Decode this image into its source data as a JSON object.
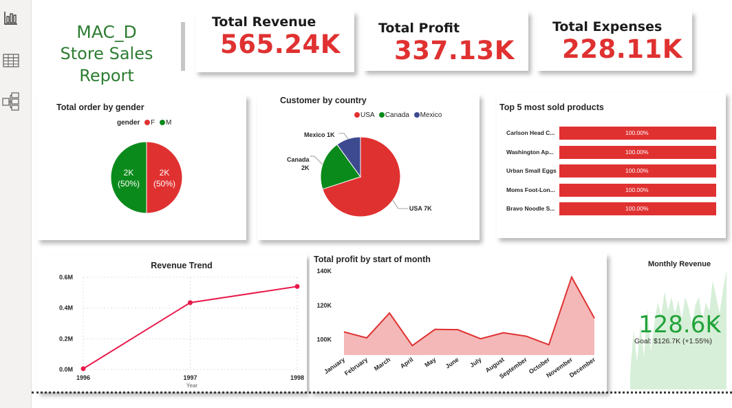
{
  "report": {
    "title_line1": "MAC_D",
    "title_line2": "Store Sales Report"
  },
  "kpis": [
    {
      "label": "Total Revenue",
      "value": "565.24K"
    },
    {
      "label": "Total Profit",
      "value": "337.13K"
    },
    {
      "label": "Total Expenses",
      "value": "228.11K"
    }
  ],
  "nav": [
    {
      "name": "report-view",
      "icon": "bar-chart-icon"
    },
    {
      "name": "table-view",
      "icon": "table-icon"
    },
    {
      "name": "model-view",
      "icon": "model-icon"
    }
  ],
  "colors": {
    "red": "#e03131",
    "green": "#0a8a1a",
    "navy": "#3e4a8f",
    "title_green": "#2e7d32",
    "kpi_green": "#22a33a"
  },
  "chart_data": [
    {
      "id": "gender",
      "type": "pie",
      "title": "Total order by gender",
      "legend_title": "gender",
      "legend_position": "top",
      "categories": [
        "F",
        "M"
      ],
      "values": [
        2000,
        2000
      ],
      "labels": [
        {
          "line1": "2K",
          "line2": "(50%)"
        },
        {
          "line1": "2K",
          "line2": "(50%)"
        }
      ],
      "colors": [
        "#e03131",
        "#0a8a1a"
      ]
    },
    {
      "id": "country",
      "type": "pie",
      "title": "Customer by country",
      "legend_position": "top",
      "categories": [
        "USA",
        "Canada",
        "Mexico"
      ],
      "values": [
        7000,
        2000,
        1000
      ],
      "labels": [
        "USA 7K",
        "Canada",
        "2K",
        "Mexico 1K"
      ],
      "colors": [
        "#e03131",
        "#0a8a1a",
        "#3e4a8f"
      ]
    },
    {
      "id": "top-products",
      "type": "bar",
      "title": "Top 5 most sold products",
      "categories": [
        "Carlson Head C...",
        "Washington Ap...",
        "Urban Small Eggs",
        "Moms Foot-Lon...",
        "Bravo Noodle S..."
      ],
      "values": [
        100,
        100,
        100,
        100,
        100
      ],
      "value_labels": [
        "100.00%",
        "100.00%",
        "100.00%",
        "100.00%",
        "100.00%"
      ],
      "ylim": [
        0,
        100
      ]
    },
    {
      "id": "revenue-trend",
      "type": "line",
      "title": "Revenue Trend",
      "xlabel": "Year",
      "ylabel": "",
      "x": [
        "1996",
        "1997",
        "1998"
      ],
      "values": [
        0.005,
        0.435,
        0.54
      ],
      "ylim": [
        0,
        0.6
      ],
      "yticks": [
        "0.0M",
        "0.2M",
        "0.4M",
        "0.6M"
      ],
      "color": "#e8194a",
      "grid": true
    },
    {
      "id": "profit-by-month",
      "type": "area",
      "title": "Total profit by start of month",
      "categories": [
        "January",
        "February",
        "March",
        "April",
        "May",
        "June",
        "July",
        "August",
        "September",
        "October",
        "November",
        "December"
      ],
      "values": [
        104500,
        101000,
        115500,
        96500,
        106000,
        105800,
        100500,
        104000,
        102000,
        97000,
        136500,
        112500
      ],
      "ylim": [
        91000,
        140000
      ],
      "yticks": [
        "100K",
        "120K",
        "140K"
      ],
      "color": "#e03131"
    },
    {
      "id": "monthly-revenue",
      "type": "area",
      "title": "Monthly Revenue",
      "value": "128.6K",
      "goal": "Goal: $126.7K (+1.55%)",
      "status_icon": "check-icon",
      "values": [
        0.15,
        0.55,
        0.25,
        0.6,
        0.3,
        0.75,
        0.35,
        0.6,
        0.8,
        0.68,
        0.9,
        0.72,
        0.85,
        0.7,
        0.82,
        0.65,
        0.85,
        0.75,
        0.6,
        0.78,
        0.85,
        0.62,
        0.8,
        0.72,
        1.0,
        0.85,
        0.7,
        0.92,
        1.1
      ],
      "color": "#22a33a"
    }
  ]
}
